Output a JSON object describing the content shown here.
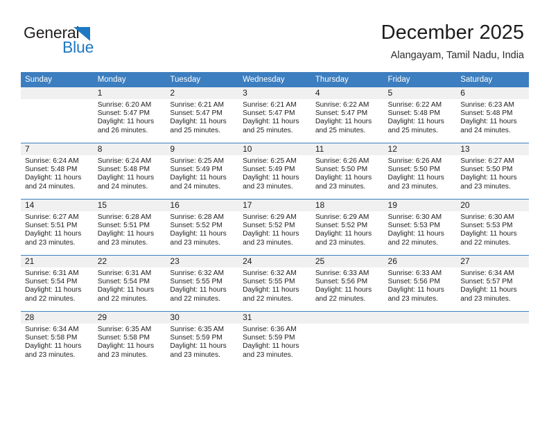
{
  "brand": {
    "name_top": "General",
    "name_bottom": "Blue",
    "triangle_icon": "blue-triangle-icon",
    "accent_color": "#1f78c1"
  },
  "header": {
    "title": "December 2025",
    "subtitle": "Alangayam, Tamil Nadu, India"
  },
  "theme": {
    "header_row_bg": "#3c7ebf",
    "daynum_bg": "#f0f0f0",
    "text_color": "#1c1c1c"
  },
  "calendar": {
    "weekday_headers": [
      "Sunday",
      "Monday",
      "Tuesday",
      "Wednesday",
      "Thursday",
      "Friday",
      "Saturday"
    ],
    "weeks": [
      [
        {
          "day": "",
          "sunrise": "",
          "sunset": "",
          "daylight_1": "",
          "daylight_2": "",
          "empty": true
        },
        {
          "day": "1",
          "sunrise": "Sunrise: 6:20 AM",
          "sunset": "Sunset: 5:47 PM",
          "daylight_1": "Daylight: 11 hours",
          "daylight_2": "and 26 minutes."
        },
        {
          "day": "2",
          "sunrise": "Sunrise: 6:21 AM",
          "sunset": "Sunset: 5:47 PM",
          "daylight_1": "Daylight: 11 hours",
          "daylight_2": "and 25 minutes."
        },
        {
          "day": "3",
          "sunrise": "Sunrise: 6:21 AM",
          "sunset": "Sunset: 5:47 PM",
          "daylight_1": "Daylight: 11 hours",
          "daylight_2": "and 25 minutes."
        },
        {
          "day": "4",
          "sunrise": "Sunrise: 6:22 AM",
          "sunset": "Sunset: 5:47 PM",
          "daylight_1": "Daylight: 11 hours",
          "daylight_2": "and 25 minutes."
        },
        {
          "day": "5",
          "sunrise": "Sunrise: 6:22 AM",
          "sunset": "Sunset: 5:48 PM",
          "daylight_1": "Daylight: 11 hours",
          "daylight_2": "and 25 minutes."
        },
        {
          "day": "6",
          "sunrise": "Sunrise: 6:23 AM",
          "sunset": "Sunset: 5:48 PM",
          "daylight_1": "Daylight: 11 hours",
          "daylight_2": "and 24 minutes."
        }
      ],
      [
        {
          "day": "7",
          "sunrise": "Sunrise: 6:24 AM",
          "sunset": "Sunset: 5:48 PM",
          "daylight_1": "Daylight: 11 hours",
          "daylight_2": "and 24 minutes."
        },
        {
          "day": "8",
          "sunrise": "Sunrise: 6:24 AM",
          "sunset": "Sunset: 5:48 PM",
          "daylight_1": "Daylight: 11 hours",
          "daylight_2": "and 24 minutes."
        },
        {
          "day": "9",
          "sunrise": "Sunrise: 6:25 AM",
          "sunset": "Sunset: 5:49 PM",
          "daylight_1": "Daylight: 11 hours",
          "daylight_2": "and 24 minutes."
        },
        {
          "day": "10",
          "sunrise": "Sunrise: 6:25 AM",
          "sunset": "Sunset: 5:49 PM",
          "daylight_1": "Daylight: 11 hours",
          "daylight_2": "and 23 minutes."
        },
        {
          "day": "11",
          "sunrise": "Sunrise: 6:26 AM",
          "sunset": "Sunset: 5:50 PM",
          "daylight_1": "Daylight: 11 hours",
          "daylight_2": "and 23 minutes."
        },
        {
          "day": "12",
          "sunrise": "Sunrise: 6:26 AM",
          "sunset": "Sunset: 5:50 PM",
          "daylight_1": "Daylight: 11 hours",
          "daylight_2": "and 23 minutes."
        },
        {
          "day": "13",
          "sunrise": "Sunrise: 6:27 AM",
          "sunset": "Sunset: 5:50 PM",
          "daylight_1": "Daylight: 11 hours",
          "daylight_2": "and 23 minutes."
        }
      ],
      [
        {
          "day": "14",
          "sunrise": "Sunrise: 6:27 AM",
          "sunset": "Sunset: 5:51 PM",
          "daylight_1": "Daylight: 11 hours",
          "daylight_2": "and 23 minutes."
        },
        {
          "day": "15",
          "sunrise": "Sunrise: 6:28 AM",
          "sunset": "Sunset: 5:51 PM",
          "daylight_1": "Daylight: 11 hours",
          "daylight_2": "and 23 minutes."
        },
        {
          "day": "16",
          "sunrise": "Sunrise: 6:28 AM",
          "sunset": "Sunset: 5:52 PM",
          "daylight_1": "Daylight: 11 hours",
          "daylight_2": "and 23 minutes."
        },
        {
          "day": "17",
          "sunrise": "Sunrise: 6:29 AM",
          "sunset": "Sunset: 5:52 PM",
          "daylight_1": "Daylight: 11 hours",
          "daylight_2": "and 23 minutes."
        },
        {
          "day": "18",
          "sunrise": "Sunrise: 6:29 AM",
          "sunset": "Sunset: 5:52 PM",
          "daylight_1": "Daylight: 11 hours",
          "daylight_2": "and 23 minutes."
        },
        {
          "day": "19",
          "sunrise": "Sunrise: 6:30 AM",
          "sunset": "Sunset: 5:53 PM",
          "daylight_1": "Daylight: 11 hours",
          "daylight_2": "and 22 minutes."
        },
        {
          "day": "20",
          "sunrise": "Sunrise: 6:30 AM",
          "sunset": "Sunset: 5:53 PM",
          "daylight_1": "Daylight: 11 hours",
          "daylight_2": "and 22 minutes."
        }
      ],
      [
        {
          "day": "21",
          "sunrise": "Sunrise: 6:31 AM",
          "sunset": "Sunset: 5:54 PM",
          "daylight_1": "Daylight: 11 hours",
          "daylight_2": "and 22 minutes."
        },
        {
          "day": "22",
          "sunrise": "Sunrise: 6:31 AM",
          "sunset": "Sunset: 5:54 PM",
          "daylight_1": "Daylight: 11 hours",
          "daylight_2": "and 22 minutes."
        },
        {
          "day": "23",
          "sunrise": "Sunrise: 6:32 AM",
          "sunset": "Sunset: 5:55 PM",
          "daylight_1": "Daylight: 11 hours",
          "daylight_2": "and 22 minutes."
        },
        {
          "day": "24",
          "sunrise": "Sunrise: 6:32 AM",
          "sunset": "Sunset: 5:55 PM",
          "daylight_1": "Daylight: 11 hours",
          "daylight_2": "and 22 minutes."
        },
        {
          "day": "25",
          "sunrise": "Sunrise: 6:33 AM",
          "sunset": "Sunset: 5:56 PM",
          "daylight_1": "Daylight: 11 hours",
          "daylight_2": "and 22 minutes."
        },
        {
          "day": "26",
          "sunrise": "Sunrise: 6:33 AM",
          "sunset": "Sunset: 5:56 PM",
          "daylight_1": "Daylight: 11 hours",
          "daylight_2": "and 23 minutes."
        },
        {
          "day": "27",
          "sunrise": "Sunrise: 6:34 AM",
          "sunset": "Sunset: 5:57 PM",
          "daylight_1": "Daylight: 11 hours",
          "daylight_2": "and 23 minutes."
        }
      ],
      [
        {
          "day": "28",
          "sunrise": "Sunrise: 6:34 AM",
          "sunset": "Sunset: 5:58 PM",
          "daylight_1": "Daylight: 11 hours",
          "daylight_2": "and 23 minutes."
        },
        {
          "day": "29",
          "sunrise": "Sunrise: 6:35 AM",
          "sunset": "Sunset: 5:58 PM",
          "daylight_1": "Daylight: 11 hours",
          "daylight_2": "and 23 minutes."
        },
        {
          "day": "30",
          "sunrise": "Sunrise: 6:35 AM",
          "sunset": "Sunset: 5:59 PM",
          "daylight_1": "Daylight: 11 hours",
          "daylight_2": "and 23 minutes."
        },
        {
          "day": "31",
          "sunrise": "Sunrise: 6:36 AM",
          "sunset": "Sunset: 5:59 PM",
          "daylight_1": "Daylight: 11 hours",
          "daylight_2": "and 23 minutes."
        },
        {
          "day": "",
          "sunrise": "",
          "sunset": "",
          "daylight_1": "",
          "daylight_2": "",
          "empty": true
        },
        {
          "day": "",
          "sunrise": "",
          "sunset": "",
          "daylight_1": "",
          "daylight_2": "",
          "empty": true
        },
        {
          "day": "",
          "sunrise": "",
          "sunset": "",
          "daylight_1": "",
          "daylight_2": "",
          "empty": true
        }
      ]
    ]
  }
}
